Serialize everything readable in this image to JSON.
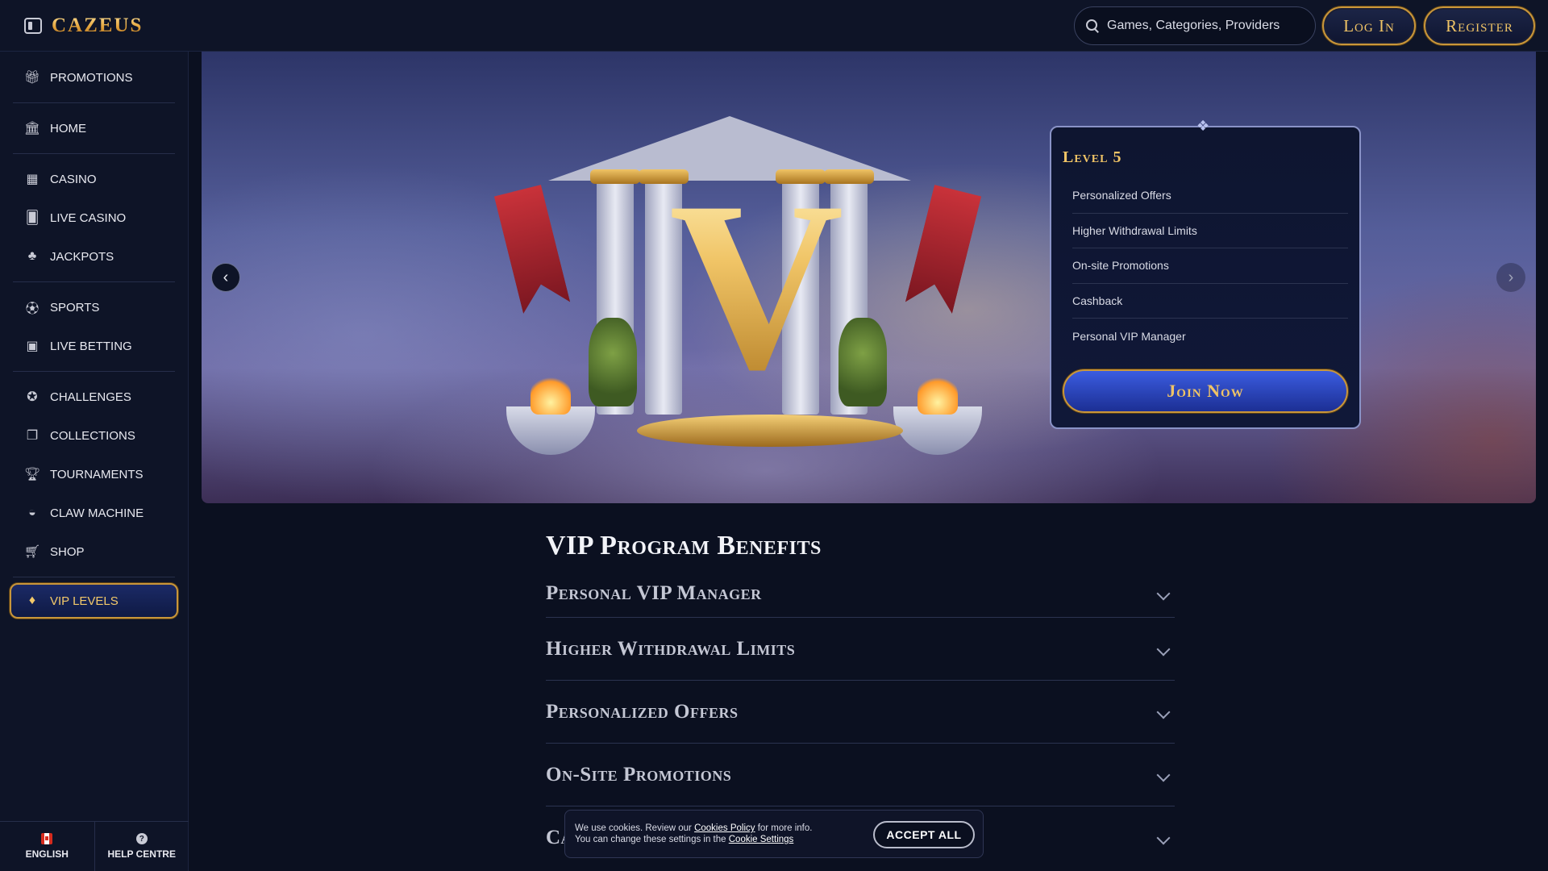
{
  "header": {
    "logo": "CAZEUS",
    "search_placeholder": "Games, Categories, Providers",
    "login_label": "Log In",
    "register_label": "Register"
  },
  "sidebar": {
    "groups": [
      [
        {
          "label": "PROMOTIONS",
          "icon": "gift-icon"
        }
      ],
      [
        {
          "label": "HOME",
          "icon": "temple-icon"
        }
      ],
      [
        {
          "label": "CASINO",
          "icon": "slot-machine-icon"
        },
        {
          "label": "LIVE CASINO",
          "icon": "cards-icon"
        },
        {
          "label": "JACKPOTS",
          "icon": "clover-icon"
        }
      ],
      [
        {
          "label": "SPORTS",
          "icon": "soccer-ball-icon"
        },
        {
          "label": "LIVE BETTING",
          "icon": "live-tv-icon"
        }
      ],
      [
        {
          "label": "CHALLENGES",
          "icon": "medal-icon"
        },
        {
          "label": "COLLECTIONS",
          "icon": "collection-icon"
        },
        {
          "label": "TOURNAMENTS",
          "icon": "trophy-icon"
        },
        {
          "label": "CLAW MACHINE",
          "icon": "claw-icon"
        },
        {
          "label": "SHOP",
          "icon": "cart-icon"
        }
      ]
    ],
    "vip_label": "VIP LEVELS",
    "language_label": "ENGLISH",
    "help_label": "HELP CENTRE"
  },
  "banner": {
    "level_title": "Level 5",
    "benefits": [
      "Personalized Offers",
      "Higher Withdrawal Limits",
      "On-site Promotions",
      "Cashback",
      "Personal VIP Manager"
    ],
    "join_label": "Join Now"
  },
  "benefits_section": {
    "title": "VIP Program Benefits",
    "items": [
      "Personal VIP Manager",
      "Higher Withdrawal Limits",
      "Personalized Offers",
      "On-Site Promotions",
      "Ca"
    ]
  },
  "cookie": {
    "text_1": "We use cookies. Review our ",
    "policy_link": "Cookies Policy",
    "text_2": " for more info.",
    "text_3": "You can change these settings in the ",
    "settings_link": "Cookie Settings",
    "accept_label": "ACCEPT ALL"
  },
  "colors": {
    "gold": "#f0c466",
    "background": "#0b1020",
    "panel": "#0e1427",
    "vip_blue": "#1b2a66"
  }
}
